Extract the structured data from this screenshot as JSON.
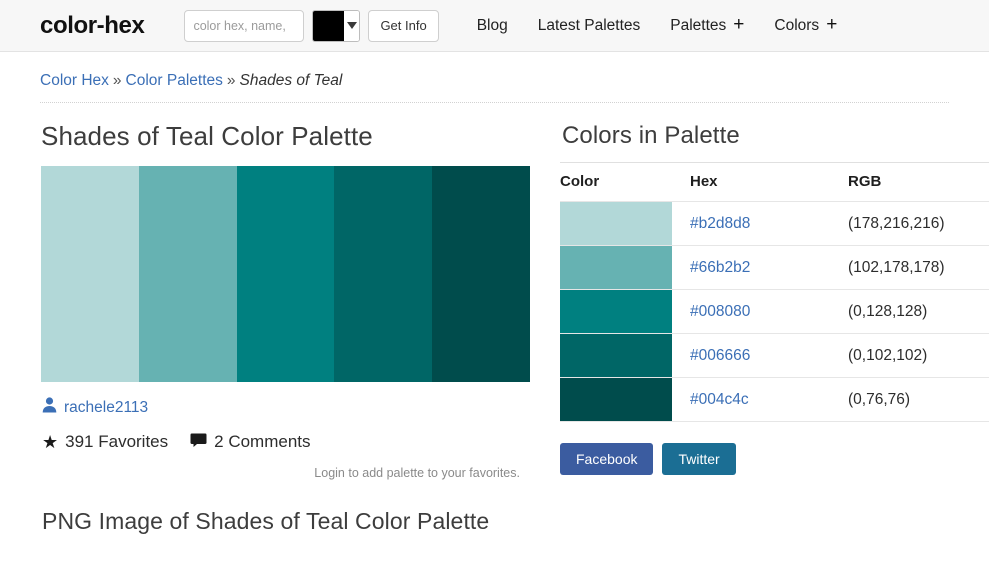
{
  "header": {
    "logo": "color-hex",
    "search": {
      "placeholder": "color hex, name,",
      "value": "",
      "picker_color": "#000000",
      "get_info_label": "Get Info"
    },
    "nav": [
      {
        "label": "Blog",
        "has_plus": false
      },
      {
        "label": "Latest Palettes",
        "has_plus": false
      },
      {
        "label": "Palettes",
        "has_plus": true,
        "plus": "+"
      },
      {
        "label": "Colors",
        "has_plus": true,
        "plus": "+"
      }
    ]
  },
  "breadcrumb": {
    "items": [
      {
        "label": "Color Hex",
        "link": true
      },
      {
        "label": "Color Palettes",
        "link": true
      },
      {
        "label": "Shades of Teal",
        "link": false
      }
    ],
    "separator": "»"
  },
  "main": {
    "title": "Shades of Teal Color Palette",
    "palette_colors": [
      "#b2d8d8",
      "#66b2b2",
      "#008080",
      "#006666",
      "#004c4c"
    ],
    "author": {
      "icon": "person-icon",
      "username": "rachele2113"
    },
    "stats": {
      "favorites_icon": "star-icon",
      "favorites": "391 Favorites",
      "comments_icon": "comment-icon",
      "comments": "2 Comments"
    },
    "login_note": "Login to add palette to your favorites.",
    "png_title": "PNG Image of Shades of Teal Color Palette"
  },
  "sidebar": {
    "title": "Colors in Palette",
    "table": {
      "headers": [
        "Color",
        "Hex",
        "RGB"
      ],
      "rows": [
        {
          "color": "#b2d8d8",
          "hex": "#b2d8d8",
          "rgb": "(178,216,216)"
        },
        {
          "color": "#66b2b2",
          "hex": "#66b2b2",
          "rgb": "(102,178,178)"
        },
        {
          "color": "#008080",
          "hex": "#008080",
          "rgb": "(0,128,128)"
        },
        {
          "color": "#006666",
          "hex": "#006666",
          "rgb": "(0,102,102)"
        },
        {
          "color": "#004c4c",
          "hex": "#004c4c",
          "rgb": "(0,76,76)"
        }
      ]
    },
    "social": [
      {
        "label": "Facebook",
        "color": "#3b5ca0"
      },
      {
        "label": "Twitter",
        "color": "#1b6e94"
      }
    ]
  }
}
